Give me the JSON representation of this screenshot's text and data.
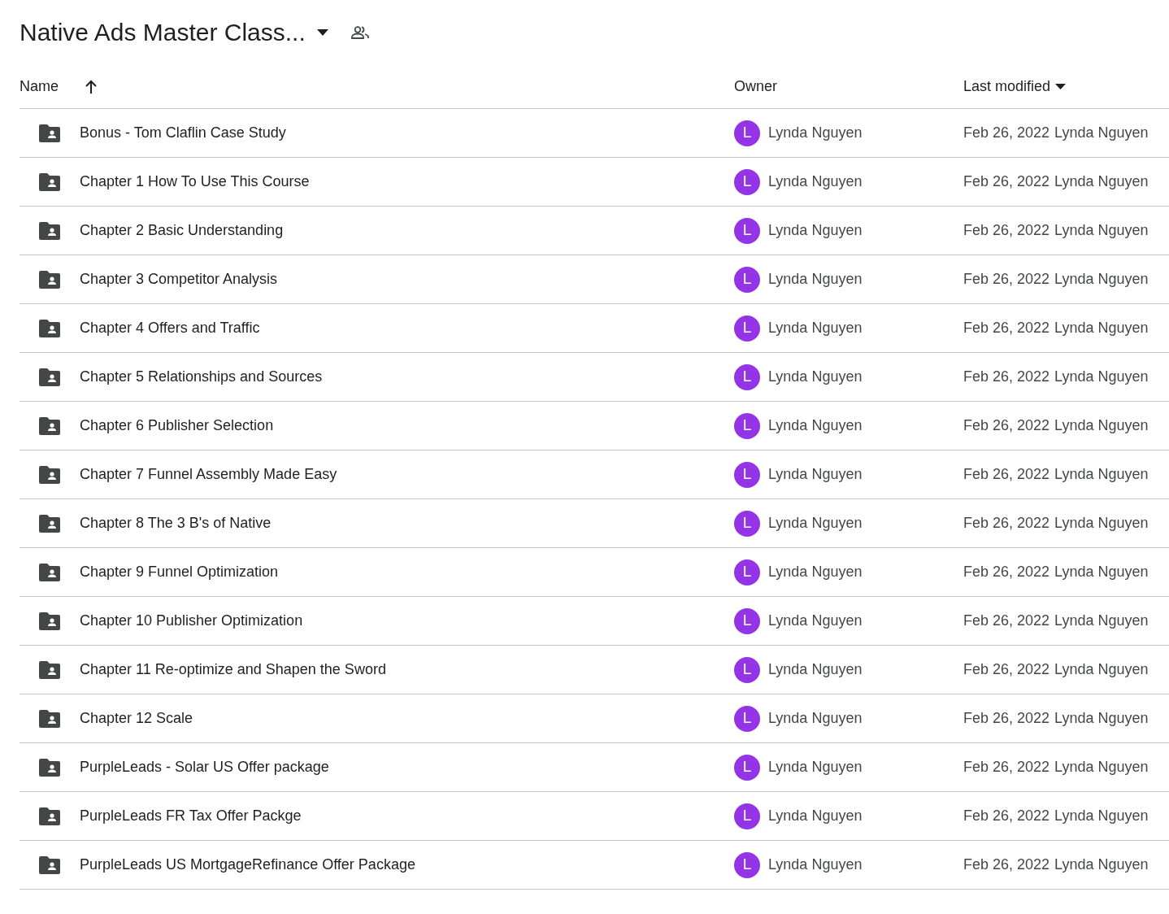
{
  "folder": {
    "title": "Native Ads Master Class..."
  },
  "table": {
    "columns": [
      {
        "label": "Name"
      },
      {
        "label": "Owner"
      },
      {
        "label": "Last modified"
      }
    ],
    "rows": [
      {
        "name": "Bonus - Tom Claflin Case Study",
        "owner_initial": "L",
        "owner": "Lynda Nguyen",
        "modified_date": "Feb 26, 2022",
        "modified_by": "Lynda Nguyen"
      },
      {
        "name": "Chapter 1 How To Use This Course",
        "owner_initial": "L",
        "owner": "Lynda Nguyen",
        "modified_date": "Feb 26, 2022",
        "modified_by": "Lynda Nguyen"
      },
      {
        "name": "Chapter 2 Basic Understanding",
        "owner_initial": "L",
        "owner": "Lynda Nguyen",
        "modified_date": "Feb 26, 2022",
        "modified_by": "Lynda Nguyen"
      },
      {
        "name": "Chapter 3 Competitor Analysis",
        "owner_initial": "L",
        "owner": "Lynda Nguyen",
        "modified_date": "Feb 26, 2022",
        "modified_by": "Lynda Nguyen"
      },
      {
        "name": "Chapter 4 Offers and Traffic",
        "owner_initial": "L",
        "owner": "Lynda Nguyen",
        "modified_date": "Feb 26, 2022",
        "modified_by": "Lynda Nguyen"
      },
      {
        "name": "Chapter 5 Relationships and Sources",
        "owner_initial": "L",
        "owner": "Lynda Nguyen",
        "modified_date": "Feb 26, 2022",
        "modified_by": "Lynda Nguyen"
      },
      {
        "name": "Chapter 6 Publisher Selection",
        "owner_initial": "L",
        "owner": "Lynda Nguyen",
        "modified_date": "Feb 26, 2022",
        "modified_by": "Lynda Nguyen"
      },
      {
        "name": "Chapter 7 Funnel Assembly Made Easy",
        "owner_initial": "L",
        "owner": "Lynda Nguyen",
        "modified_date": "Feb 26, 2022",
        "modified_by": "Lynda Nguyen"
      },
      {
        "name": "Chapter 8 The 3 B's of Native",
        "owner_initial": "L",
        "owner": "Lynda Nguyen",
        "modified_date": "Feb 26, 2022",
        "modified_by": "Lynda Nguyen"
      },
      {
        "name": "Chapter 9 Funnel Optimization",
        "owner_initial": "L",
        "owner": "Lynda Nguyen",
        "modified_date": "Feb 26, 2022",
        "modified_by": "Lynda Nguyen"
      },
      {
        "name": "Chapter 10 Publisher Optimization",
        "owner_initial": "L",
        "owner": "Lynda Nguyen",
        "modified_date": "Feb 26, 2022",
        "modified_by": "Lynda Nguyen"
      },
      {
        "name": "Chapter 11 Re-optimize and Shapen the Sword",
        "owner_initial": "L",
        "owner": "Lynda Nguyen",
        "modified_date": "Feb 26, 2022",
        "modified_by": "Lynda Nguyen"
      },
      {
        "name": "Chapter 12 Scale",
        "owner_initial": "L",
        "owner": "Lynda Nguyen",
        "modified_date": "Feb 26, 2022",
        "modified_by": "Lynda Nguyen"
      },
      {
        "name": "PurpleLeads - Solar US Offer package",
        "owner_initial": "L",
        "owner": "Lynda Nguyen",
        "modified_date": "Feb 26, 2022",
        "modified_by": "Lynda Nguyen"
      },
      {
        "name": "PurpleLeads FR Tax Offer Packge",
        "owner_initial": "L",
        "owner": "Lynda Nguyen",
        "modified_date": "Feb 26, 2022",
        "modified_by": "Lynda Nguyen"
      },
      {
        "name": "PurpleLeads US MortgageRefinance Offer Package",
        "owner_initial": "L",
        "owner": "Lynda Nguyen",
        "modified_date": "Feb 26, 2022",
        "modified_by": "Lynda Nguyen"
      }
    ]
  }
}
